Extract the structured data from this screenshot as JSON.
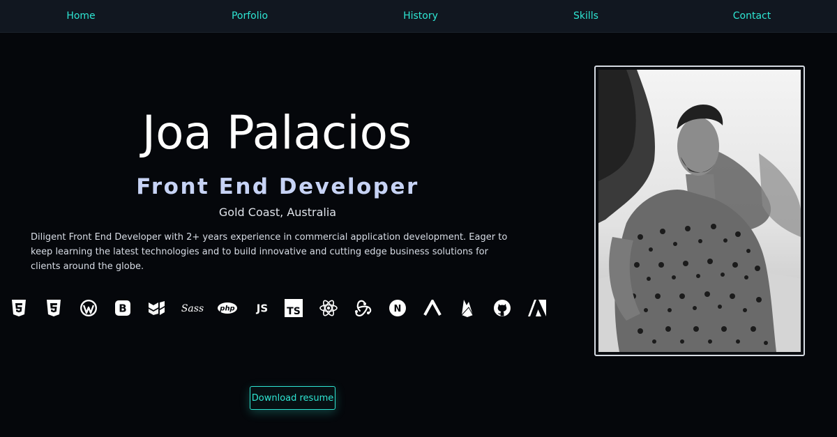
{
  "nav": {
    "items": [
      {
        "label": "Home"
      },
      {
        "label": "Porfolio"
      },
      {
        "label": "History"
      },
      {
        "label": "Skills"
      },
      {
        "label": "Contact"
      }
    ]
  },
  "hero": {
    "name": "Joa Palacios",
    "role": "Front End Developer",
    "location": "Gold Coast, Australia",
    "description": "Diligent Front End Developer with 2+ years experience in commercial application development. Eager to keep learning the latest technologies and to build innovative and cutting edge business solutions for clients around the globe."
  },
  "skills": {
    "icons": [
      "html5-icon",
      "css3-icon",
      "wordpress-icon",
      "bootstrap-icon",
      "material-ui-icon",
      "sass-icon",
      "php-icon",
      "javascript-icon",
      "typescript-icon",
      "react-icon",
      "redux-icon",
      "nextjs-icon",
      "vercel-icon",
      "firebase-icon",
      "github-icon",
      "angular-icon"
    ],
    "sass_text": "Sass",
    "php_text": "php",
    "js_text": "JS",
    "ts_text": "TS",
    "nextjs_text": "N"
  },
  "resume": {
    "label": "Download resume"
  },
  "colors": {
    "accent": "#2ee6d3",
    "background": "#05070b",
    "nav_background": "#111720",
    "role_text": "#c7d3f5"
  }
}
